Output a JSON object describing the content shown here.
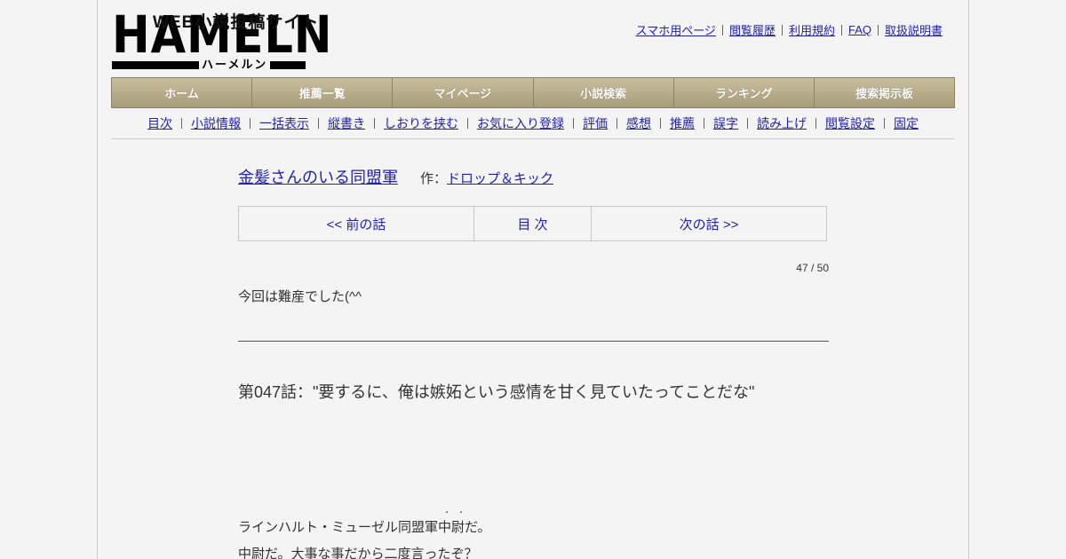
{
  "logo": {
    "tagline": "WEB小説投稿サイト",
    "wordmark": "HAMELN",
    "kana": "ハーメルン"
  },
  "header_links": [
    "スマホ用ページ",
    "閲覧履歴",
    "利用規約",
    "FAQ",
    "取扱説明書"
  ],
  "nav": [
    "ホーム",
    "推薦一覧",
    "マイページ",
    "小説検索",
    "ランキング",
    "捜索掲示板"
  ],
  "subnav": [
    "目次",
    "小説情報",
    "一括表示",
    "縦書き",
    "しおりを挟む",
    "お気に入り登録",
    "評価",
    "感想",
    "推薦",
    "誤字",
    "読み上げ",
    "閲覧設定",
    "固定"
  ],
  "novel": {
    "title": "金髪さんのいる同盟軍",
    "author_prefix": "作：",
    "author": "ドロップ＆キック"
  },
  "chapter_nav": {
    "prev": "<< 前の話",
    "index": "目 次",
    "next": "次の話 >>"
  },
  "page_counter": "47 / 50",
  "preface": "今回は難産でした(^^",
  "chapter_title": "第047話：\"要するに、俺は嫉妬という感情を甘く見ていたってことだな\"",
  "body": {
    "ruby_marks": "・・",
    "lines": [
      "ラインハルト・ミューゼル同盟軍中尉だ。",
      "中尉だ。大事な事だから二度言ったぞ？"
    ]
  }
}
